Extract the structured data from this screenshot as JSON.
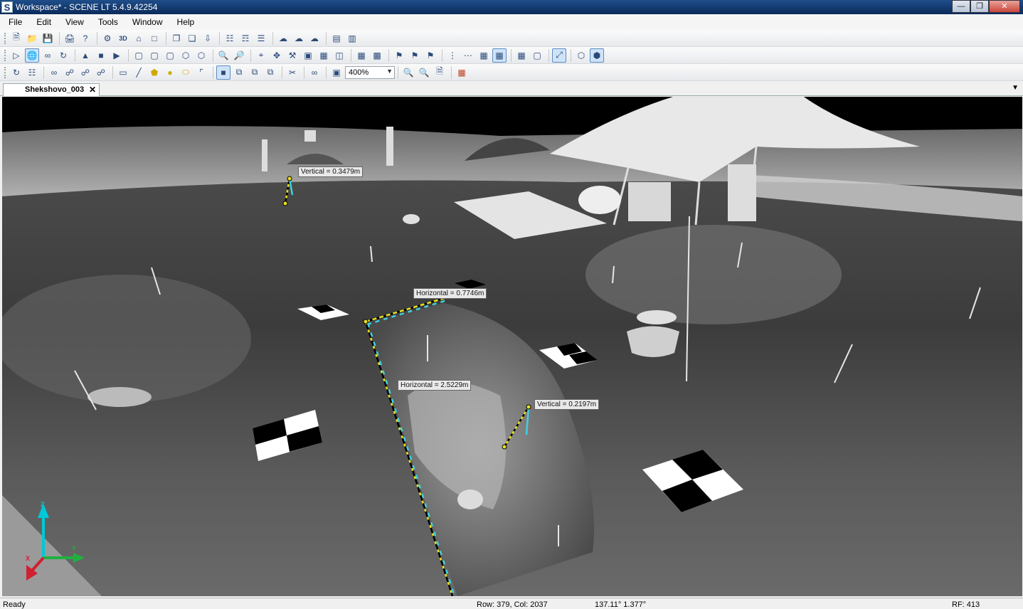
{
  "window": {
    "title": "Workspace* - SCENE LT 5.4.9.42254",
    "app_letter": "S"
  },
  "menu": [
    "File",
    "Edit",
    "View",
    "Tools",
    "Window",
    "Help"
  ],
  "toolbar": {
    "zoom_value": "400%"
  },
  "tabs": [
    {
      "label": "Shekshovo_003"
    }
  ],
  "measurements": [
    {
      "label": "Vertical = 0.3479m"
    },
    {
      "label": "Horizontal = 0.7746m"
    },
    {
      "label": "Horizontal = 2.5229m"
    },
    {
      "label": "Vertical = 0.2197m"
    }
  ],
  "axes": {
    "x": "X",
    "y": "Y",
    "z": "Z"
  },
  "status": {
    "state": "Ready",
    "rowcol": "Row: 379, Col: 2037",
    "angles": "137.11° 1.377°",
    "rf": "RF: 413"
  },
  "colors": {
    "measure_yellow": "#e8e020",
    "measure_cyan": "#40d0e0",
    "axis_z": "#00c8d8",
    "axis_y": "#20b040",
    "axis_x": "#d02030"
  }
}
